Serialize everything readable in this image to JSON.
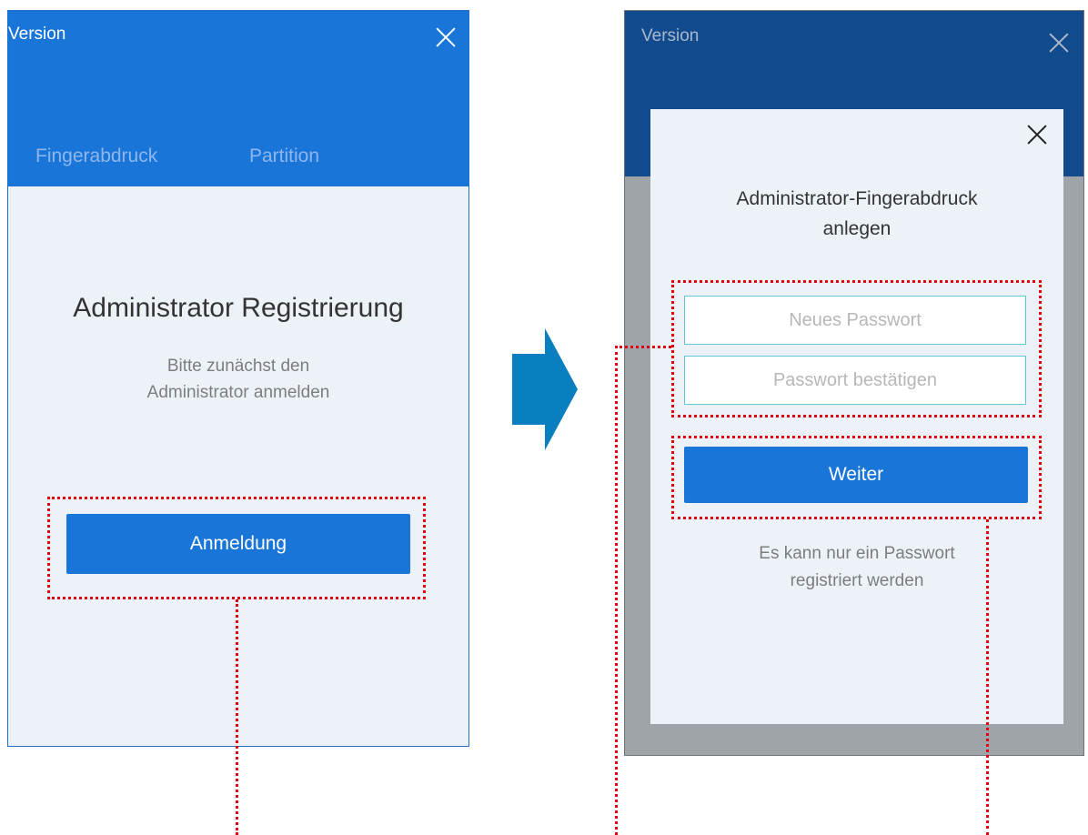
{
  "left_window": {
    "title": "Version",
    "tabs": [
      "Fingerabdruck",
      "Partition"
    ],
    "heading": "Administrator Registrierung",
    "subtext_line1": "Bitte zunächst den",
    "subtext_line2": "Administrator anmelden",
    "button_label": "Anmeldung"
  },
  "right_window": {
    "title": "Version",
    "dialog": {
      "title_line1": "Administrator-Fingerabdruck",
      "title_line2": "anlegen",
      "new_password_placeholder": "Neues Passwort",
      "confirm_password_placeholder": "Passwort bestätigen",
      "button_label": "Weiter",
      "note_line1": "Es kann nur ein Passwort",
      "note_line2": "registriert werden"
    }
  },
  "colors": {
    "primary_blue": "#1976d8",
    "dark_header": "#114b8e",
    "annotation_red": "#e3000f",
    "arrow_blue": "#0a7fbf",
    "input_border": "#5ec8d8"
  },
  "icons": [
    "close-icon",
    "right-arrow-icon"
  ]
}
